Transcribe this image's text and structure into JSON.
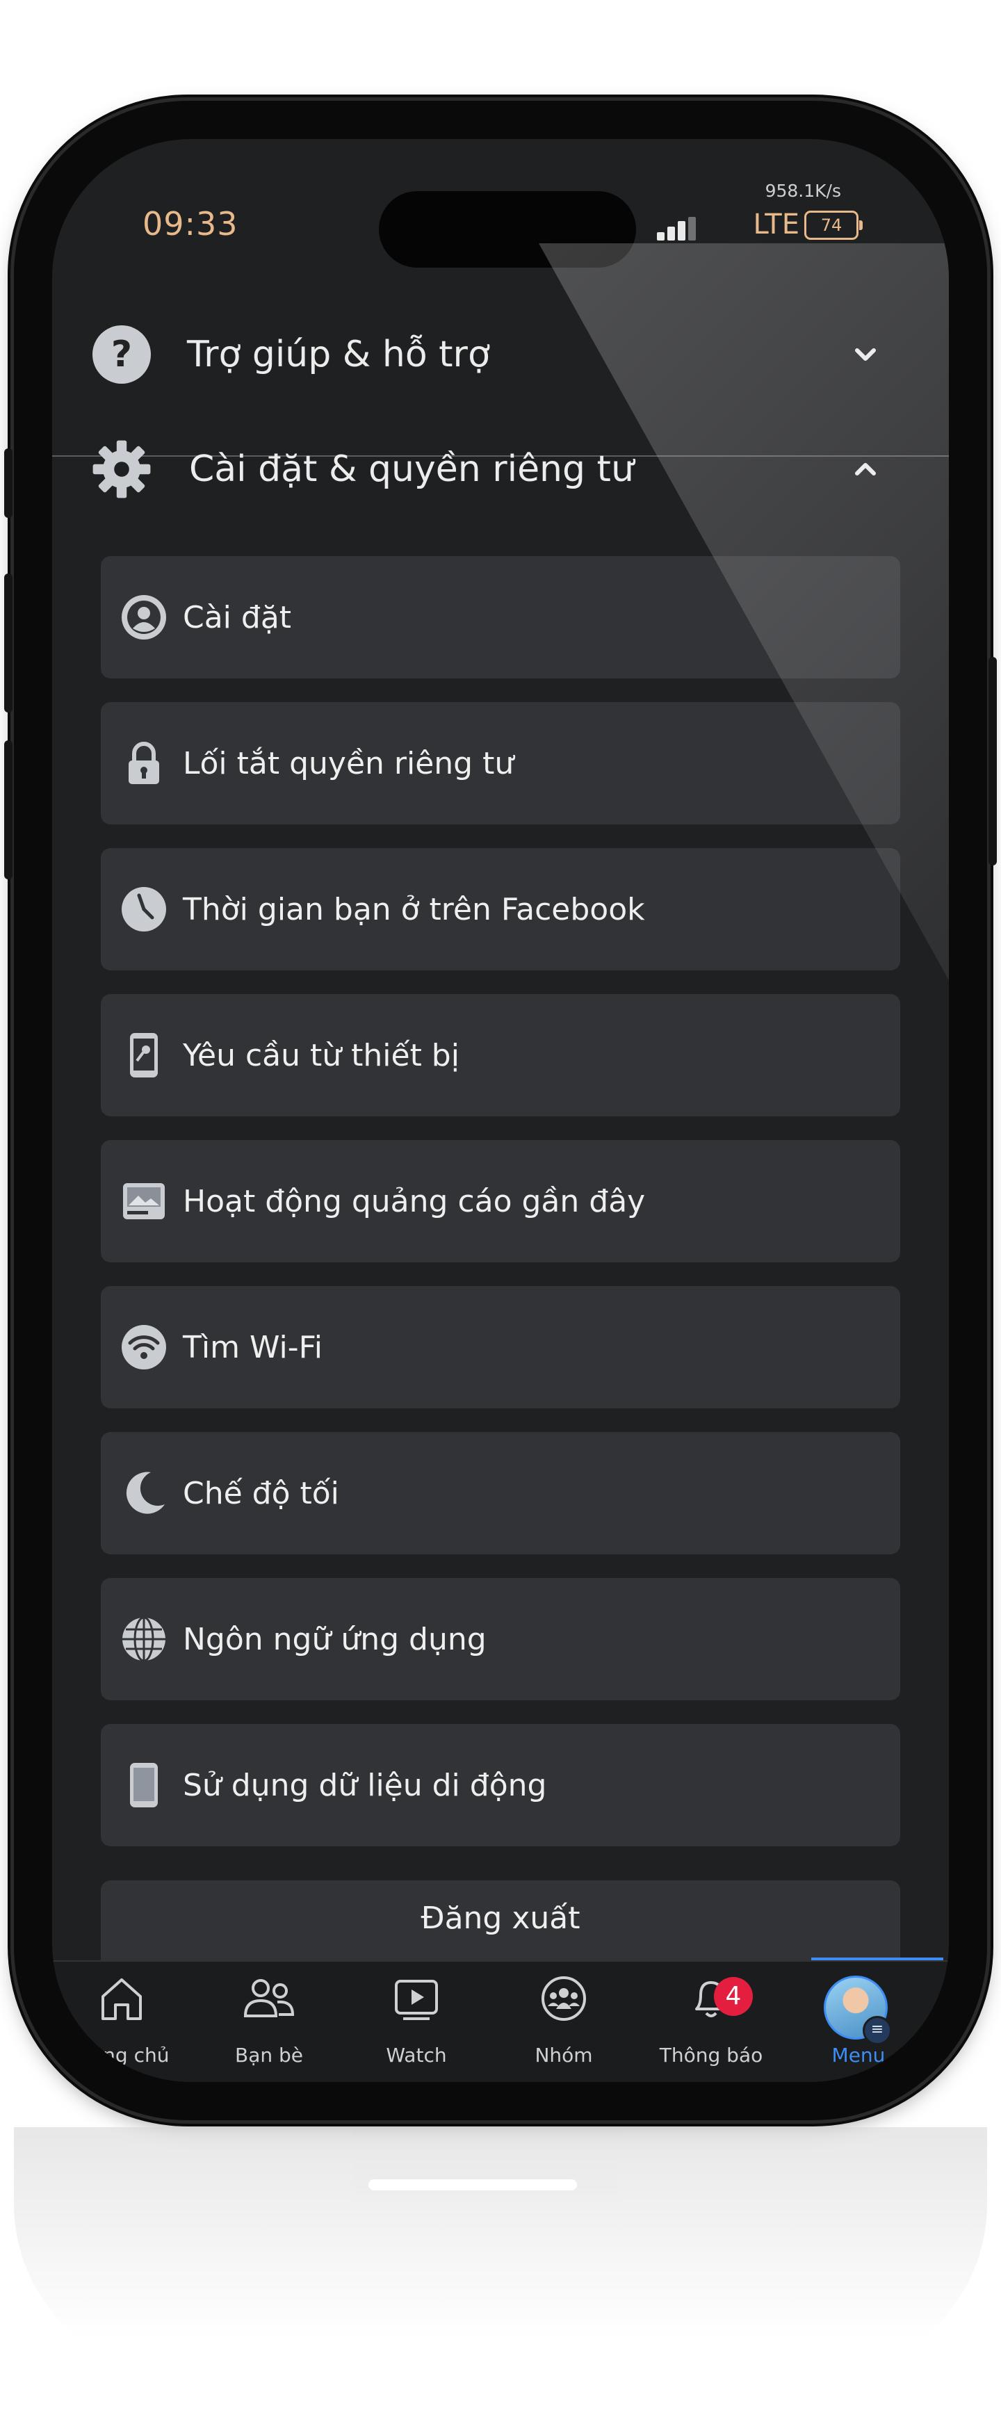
{
  "status_bar": {
    "time": "09:33",
    "net_speed": "958.1K/s",
    "network": "LTE",
    "battery": "74"
  },
  "sections": {
    "help": {
      "title": "Trợ giúp & hỗ trợ",
      "icon": "question-circle-icon",
      "expanded": false
    },
    "settings": {
      "title": "Cài đặt & quyền riêng tư",
      "icon": "gear-icon",
      "expanded": true
    }
  },
  "settings_items": [
    {
      "label": "Cài đặt",
      "icon": "user-circle-icon"
    },
    {
      "label": "Lối tắt quyền riêng tư",
      "icon": "lock-icon"
    },
    {
      "label": "Thời gian bạn ở trên Facebook",
      "icon": "clock-icon"
    },
    {
      "label": "Yêu cầu từ thiết bị",
      "icon": "phone-key-icon"
    },
    {
      "label": "Hoạt động quảng cáo gần đây",
      "icon": "ad-image-icon"
    },
    {
      "label": "Tìm Wi-Fi",
      "icon": "wifi-icon"
    },
    {
      "label": "Chế độ tối",
      "icon": "moon-icon"
    },
    {
      "label": "Ngôn ngữ ứng dụng",
      "icon": "globe-icon"
    },
    {
      "label": "Sử dụng dữ liệu di động",
      "icon": "mobile-device-icon"
    }
  ],
  "logout_label": "Đăng xuất",
  "tabs": [
    {
      "label": "Trang chủ",
      "icon": "home-icon"
    },
    {
      "label": "Bạn bè",
      "icon": "friends-icon"
    },
    {
      "label": "Watch",
      "icon": "video-play-icon"
    },
    {
      "label": "Nhóm",
      "icon": "groups-icon"
    },
    {
      "label": "Thông báo",
      "icon": "bell-icon",
      "badge": "4"
    },
    {
      "label": "Menu",
      "icon": "avatar-icon",
      "active": true
    }
  ],
  "colors": {
    "accent": "#3d8df5",
    "badge": "#e41e3f",
    "status_text": "#e8b98a",
    "background": "#1f2022",
    "card": "#323336"
  }
}
